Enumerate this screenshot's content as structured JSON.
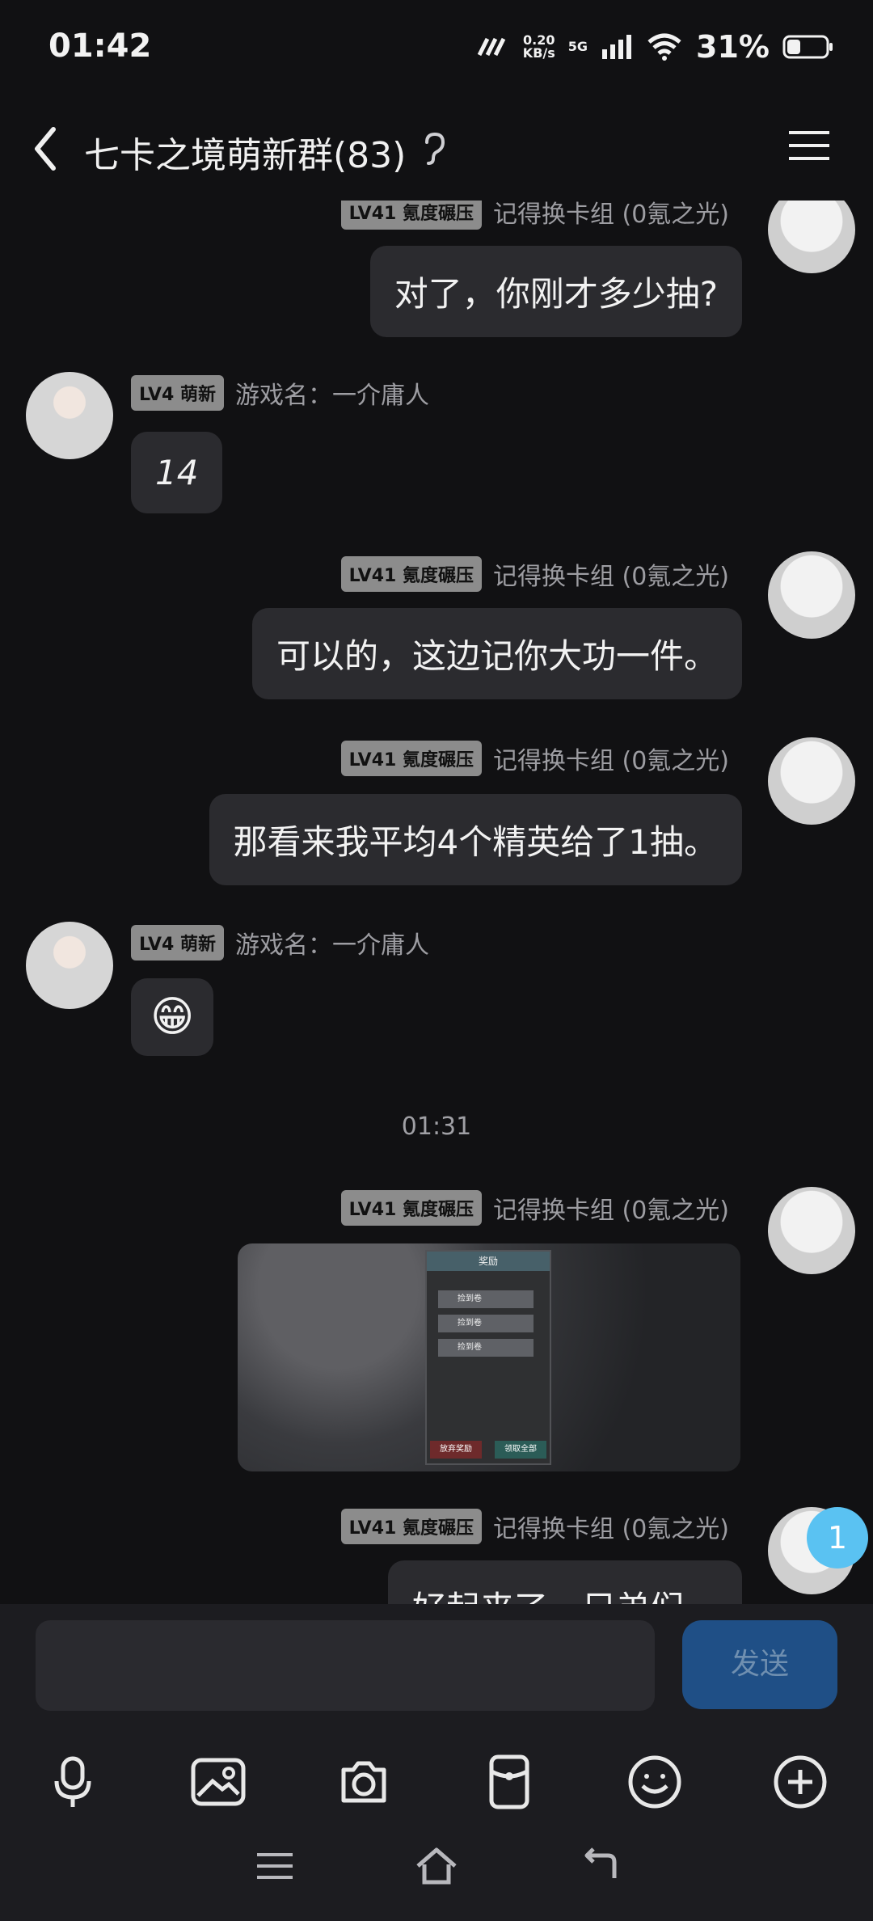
{
  "status_bar": {
    "time": "01:42",
    "network_speed": "0.20",
    "network_speed_unit": "KB/s",
    "network_type": "5G",
    "battery_percent": "31%"
  },
  "nav": {
    "title": "七卡之境萌新群(83)",
    "icons": [
      "chevron-left-icon",
      "ear-icon",
      "hamburger-menu-icon"
    ]
  },
  "messages": [
    {
      "sender": "right",
      "badge": "LV41 氪度碾压",
      "name": "记得换卡组 (0氪之光)",
      "text": "对了，你刚才多少抽?"
    },
    {
      "sender": "left",
      "badge": "LV4 萌新",
      "name": "游戏名：一介庸人",
      "text": "14"
    },
    {
      "sender": "right",
      "badge": "LV41 氪度碾压",
      "name": "记得换卡组 (0氪之光)",
      "text": "可以的，这边记你大功一件。"
    },
    {
      "sender": "right",
      "badge": "LV41 氪度碾压",
      "name": "记得换卡组 (0氪之光)",
      "text": "那看来我平均4个精英给了1抽。"
    },
    {
      "sender": "left",
      "badge": "LV4 萌新",
      "name": "游戏名：一介庸人",
      "emoji": "😁"
    },
    {
      "timestamp": "01:31"
    },
    {
      "sender": "right",
      "badge": "LV41 氪度碾压",
      "name": "记得换卡组 (0氪之光)",
      "image_panel": {
        "title": "奖励",
        "items": [
          "捡到卷",
          "捡到卷",
          "捡到卷"
        ],
        "left_button": "放弃奖励",
        "right_button": "领取全部"
      }
    },
    {
      "sender": "right",
      "badge": "LV41 氪度碾压",
      "name": "记得换卡组 (0氪之光)",
      "text": "好起来了，兄弟们。"
    }
  ],
  "unread_count": "1",
  "composer": {
    "placeholder": "",
    "send_label": "发送",
    "toolbar_icons": [
      "mic-icon",
      "image-icon",
      "camera-icon",
      "red-packet-icon",
      "emoji-icon",
      "plus-circle-icon"
    ]
  },
  "system_nav": [
    "menu-icon",
    "home-icon",
    "back-icon"
  ],
  "colors": {
    "bg": "#111113",
    "bubble": "#2b2b2f",
    "badge": "#8c8c8c",
    "send": "#1f4f86",
    "unread": "#5ac2f2"
  }
}
